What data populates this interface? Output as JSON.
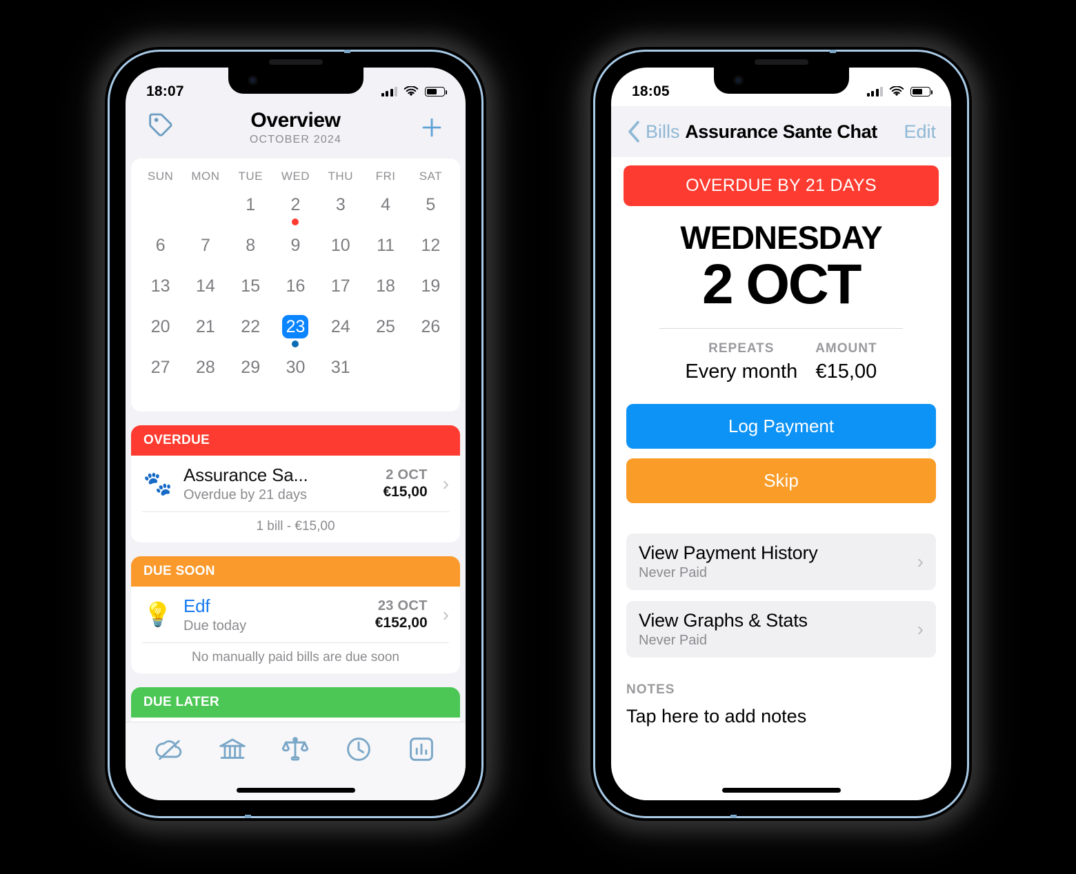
{
  "phone1": {
    "status": {
      "time": "18:07",
      "signal_icon": "cellular-bars-icon",
      "wifi_icon": "wifi-icon",
      "battery_icon": "battery-icon"
    },
    "nav": {
      "tag_icon": "tag-icon",
      "title": "Overview",
      "subtitle": "OCTOBER 2024",
      "add_icon": "plus-icon"
    },
    "calendar": {
      "weekdays": [
        "SUN",
        "MON",
        "TUE",
        "WED",
        "THU",
        "FRI",
        "SAT"
      ],
      "lead_blanks": 2,
      "days": [
        1,
        2,
        3,
        4,
        5,
        6,
        7,
        8,
        9,
        10,
        11,
        12,
        13,
        14,
        15,
        16,
        17,
        18,
        19,
        20,
        21,
        22,
        23,
        24,
        25,
        26,
        27,
        28,
        29,
        30,
        31
      ],
      "selected_day": 23,
      "markers": [
        {
          "day": 2,
          "color": "#ff3b30"
        },
        {
          "day": 23,
          "color": "#0b6cb5"
        }
      ]
    },
    "sections": [
      {
        "header": "OVERDUE",
        "header_color": "#fd3b30",
        "rows": [
          {
            "icon": "🐾",
            "icon_name": "paw-print-icon",
            "name": "Assurance Sa...",
            "sub": "Overdue by 21 days",
            "date": "2 OCT",
            "amount": "€15,00",
            "name_is_link": false
          }
        ],
        "footer": "1 bill - €15,00"
      },
      {
        "header": "DUE SOON",
        "header_color": "#fb9a2c",
        "rows": [
          {
            "icon": "💡",
            "icon_name": "light-bulb-icon",
            "name": "Edf",
            "sub": "Due today",
            "date": "23 OCT",
            "amount": "€152,00",
            "name_is_link": true
          }
        ],
        "footer": "No manually paid bills are due soon"
      },
      {
        "header": "DUE LATER",
        "header_color": "#4cc755",
        "rows": [],
        "footer": ""
      }
    ],
    "tabbar": [
      {
        "icon_name": "cloud-slash-icon",
        "label": ""
      },
      {
        "icon_name": "bank-icon",
        "label": ""
      },
      {
        "icon_name": "scales-icon",
        "label": ""
      },
      {
        "icon_name": "clock-icon",
        "label": ""
      },
      {
        "icon_name": "bar-chart-icon",
        "label": ""
      }
    ]
  },
  "phone2": {
    "status": {
      "time": "18:05",
      "signal_icon": "cellular-bars-icon",
      "wifi_icon": "wifi-icon",
      "battery_icon": "battery-icon"
    },
    "nav": {
      "back_icon": "chevron-left-icon",
      "back_label": "Bills",
      "title": "Assurance Sante Chat",
      "edit_label": "Edit"
    },
    "banner": {
      "text": "OVERDUE BY 21 DAYS",
      "color": "#fd3b30"
    },
    "date": {
      "weekday": "WEDNESDAY",
      "day_month": "2 OCT"
    },
    "meta": [
      {
        "label": "REPEATS",
        "value": "Every month"
      },
      {
        "label": "AMOUNT",
        "value": "€15,00"
      }
    ],
    "buttons": [
      {
        "label": "Log Payment",
        "color": "#0d92f5"
      },
      {
        "label": "Skip",
        "color": "#f99c28"
      }
    ],
    "list": [
      {
        "title": "View Payment History",
        "sub": "Never Paid",
        "chevron": "chevron-right-icon"
      },
      {
        "title": "View Graphs & Stats",
        "sub": "Never Paid",
        "chevron": "chevron-right-icon"
      }
    ],
    "notes": {
      "label": "NOTES",
      "placeholder": "Tap here to add notes"
    }
  },
  "colors": {
    "accent_blue": "#0a84ff",
    "overdue_red": "#fd3b30",
    "due_soon_orange": "#fb9a2c",
    "due_later_green": "#4cc755",
    "tint_steel": "#7ba7c7"
  }
}
